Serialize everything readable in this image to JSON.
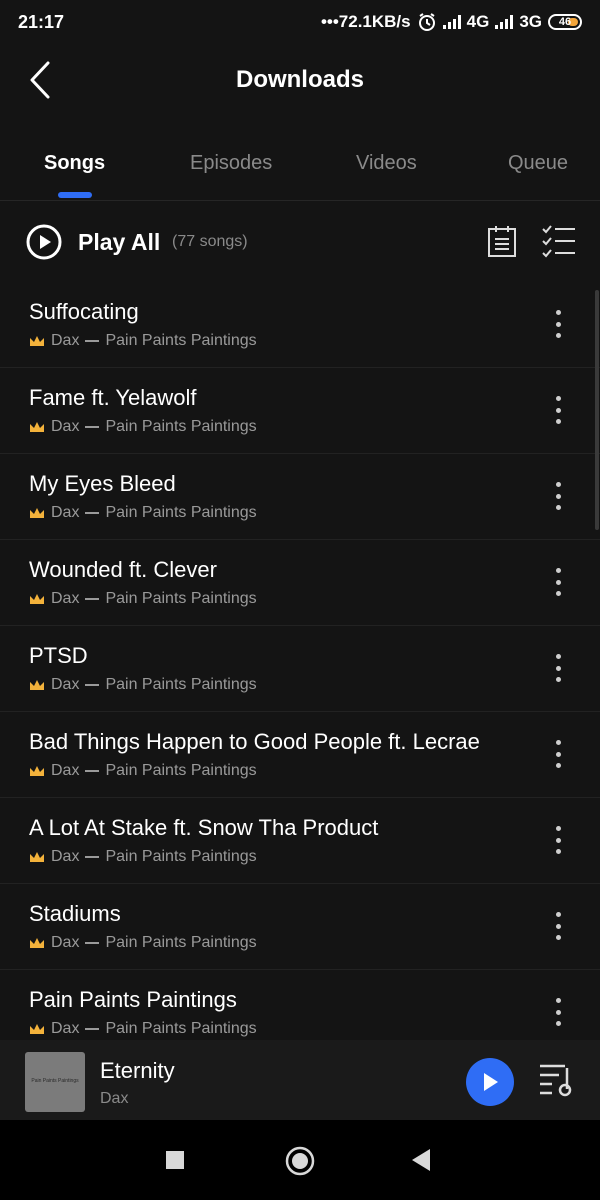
{
  "status_bar": {
    "time": "21:17",
    "network_speed": "•••72.1KB/s",
    "sim1_type": "4G",
    "sim2_type": "3G",
    "battery": "46"
  },
  "header": {
    "title": "Downloads"
  },
  "tabs": [
    {
      "label": "Songs",
      "active": true
    },
    {
      "label": "Episodes",
      "active": false
    },
    {
      "label": "Videos",
      "active": false
    },
    {
      "label": "Queue",
      "active": false
    }
  ],
  "play_all": {
    "label": "Play All",
    "count": "(77 songs)"
  },
  "songs": [
    {
      "title": "Suffocating",
      "artist": "Dax",
      "album": "Pain Paints Paintings"
    },
    {
      "title": "Fame ft. Yelawolf",
      "artist": "Dax",
      "album": "Pain Paints Paintings"
    },
    {
      "title": "My Eyes Bleed",
      "artist": "Dax",
      "album": "Pain Paints Paintings"
    },
    {
      "title": "Wounded ft. Clever",
      "artist": "Dax",
      "album": "Pain Paints Paintings"
    },
    {
      "title": "PTSD",
      "artist": "Dax",
      "album": "Pain Paints Paintings"
    },
    {
      "title": "Bad Things Happen to Good People ft. Lecrae",
      "artist": "Dax",
      "album": "Pain Paints Paintings"
    },
    {
      "title": "A Lot At Stake ft. Snow Tha Product",
      "artist": "Dax",
      "album": "Pain Paints Paintings"
    },
    {
      "title": "Stadiums",
      "artist": "Dax",
      "album": "Pain Paints Paintings"
    },
    {
      "title": "Pain Paints Paintings",
      "artist": "Dax",
      "album": "Pain Paints Paintings"
    }
  ],
  "now_playing": {
    "title": "Eternity",
    "artist": "Dax",
    "cover_text": "Pain Paints Paintings"
  },
  "colors": {
    "accent": "#2f6df5",
    "crown": "#f3b23b",
    "background": "#141414"
  },
  "icons": {
    "back": "back-arrow-icon",
    "play_all": "play-circle-icon",
    "calendar": "calendar-list-icon",
    "multiselect": "checklist-icon",
    "more": "more-vertical-icon",
    "crown": "crown-icon",
    "queue": "playlist-queue-icon"
  }
}
